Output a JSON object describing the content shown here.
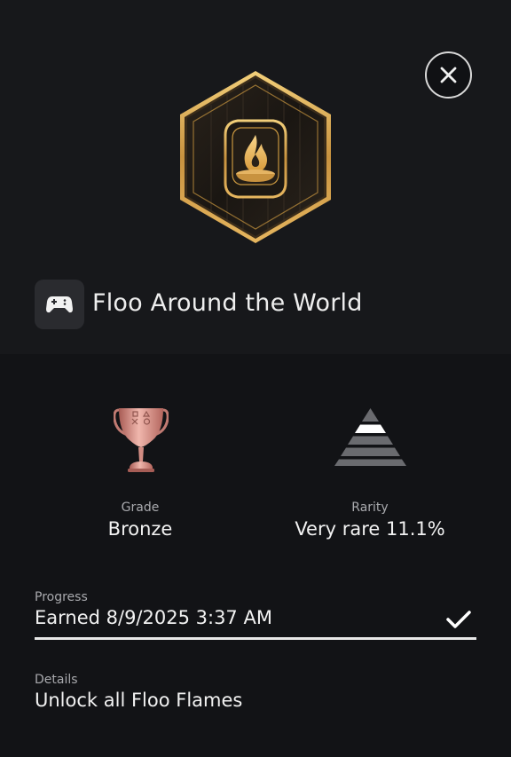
{
  "trophy": {
    "name": "Floo Around the World",
    "grade_label": "Grade",
    "grade_value": "Bronze",
    "rarity_label": "Rarity",
    "rarity_value": "Very rare 11.1%",
    "progress_label": "Progress",
    "progress_value": "Earned 8/9/2025  3:37 AM",
    "details_label": "Details",
    "details_value": "Unlock all Floo Flames"
  },
  "icons": {
    "close": "close-icon",
    "game": "gamepad-icon",
    "grade": "bronze-trophy-icon",
    "rarity": "rarity-pyramid-icon",
    "progress_status": "checkmark-icon"
  },
  "colors": {
    "background": "#121316",
    "panel": "#17181b",
    "bronze": "#d8958d",
    "gold_frame": "#d8a854"
  }
}
